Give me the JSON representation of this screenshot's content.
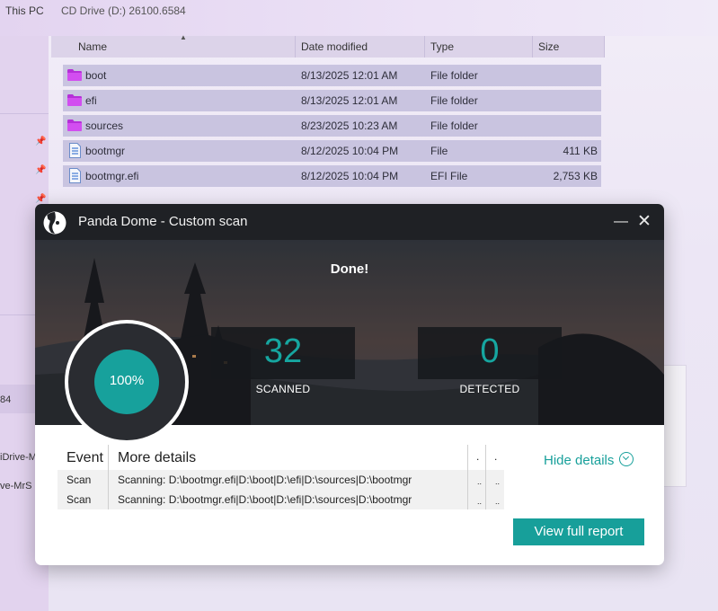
{
  "explorer": {
    "breadcrumb": [
      "This PC",
      "CD Drive (D:) 26100.6584"
    ],
    "columns": [
      "Name",
      "Date modified",
      "Type",
      "Size"
    ],
    "rows": [
      {
        "name": "boot",
        "date": "8/13/2025 12:01 AM",
        "type": "File folder",
        "size": "",
        "icon": "folder-icon"
      },
      {
        "name": "efi",
        "date": "8/13/2025 12:01 AM",
        "type": "File folder",
        "size": "",
        "icon": "folder-icon"
      },
      {
        "name": "sources",
        "date": "8/23/2025 10:23 AM",
        "type": "File folder",
        "size": "",
        "icon": "folder-icon"
      },
      {
        "name": "bootmgr",
        "date": "8/12/2025 10:04 PM",
        "type": "File",
        "size": "411 KB",
        "icon": "file-icon"
      },
      {
        "name": "bootmgr.efi",
        "date": "8/12/2025 10:04 PM",
        "type": "EFI File",
        "size": "2,753 KB",
        "icon": "file-icon"
      }
    ],
    "sidebar_partial": [
      "84",
      "iDrive-M",
      "ve-MrS"
    ]
  },
  "dialog": {
    "title": "Panda Dome - Custom scan",
    "status": "Done!",
    "progress_label": "100%",
    "progress_percent": 100,
    "scanned_value": "32",
    "scanned_label": "SCANNED",
    "detected_value": "0",
    "detected_label": "DETECTED",
    "table": {
      "headers": [
        "Event",
        "More details",
        ".",
        "."
      ],
      "rows": [
        {
          "event": "Scan",
          "details": "Scanning: D:\\bootmgr.efi|D:\\boot|D:\\efi|D:\\sources|D:\\bootmgr",
          "c3": "..",
          "c4": ".."
        },
        {
          "event": "Scan",
          "details": "Scanning: D:\\bootmgr.efi|D:\\boot|D:\\efi|D:\\sources|D:\\bootmgr",
          "c3": "..",
          "c4": ".."
        }
      ]
    },
    "hide_details_label": "Hide details",
    "report_button_label": "View full report"
  },
  "colors": {
    "accent": "#17a19c",
    "title_bar": "#1f2125",
    "folder": "#b62fd8"
  }
}
